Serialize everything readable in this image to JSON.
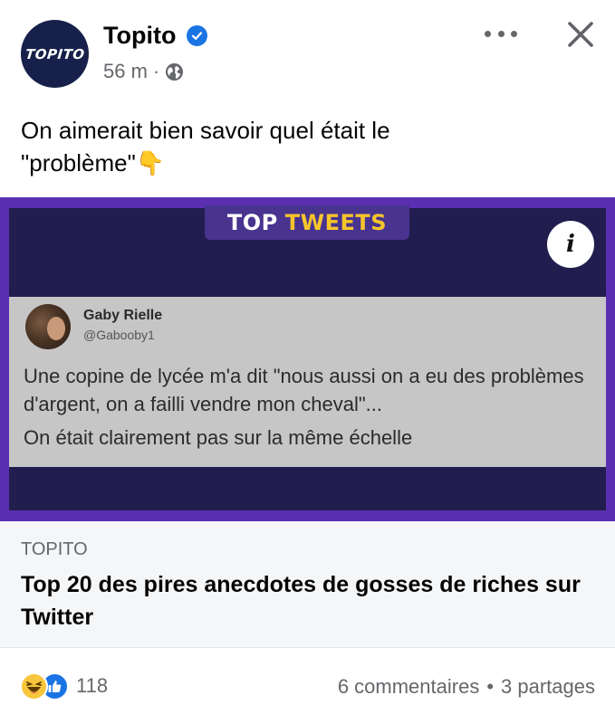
{
  "header": {
    "avatar_text": "TOPITO",
    "page_name": "Topito",
    "time": "56 m",
    "separator": "·"
  },
  "post": {
    "text_line1": "On aimerait bien savoir quel était le",
    "text_line2": "\"problème\"👇"
  },
  "image": {
    "banner_top": "TOP",
    "banner_tweets": "TWEETS",
    "info_label": "i",
    "tweet": {
      "name": "Gaby Rielle",
      "handle": "@Gabooby1",
      "text_line1": "Une copine de lycée m'a dit \"nous aussi on a eu des problèmes d'argent, on a failli vendre mon cheval\"...",
      "text_line2": "On était clairement pas sur la même échelle"
    }
  },
  "link_preview": {
    "source": "TOPITO",
    "title": "Top 20 des pires anecdotes de gosses de riches sur Twitter"
  },
  "footer": {
    "reaction_count": "118",
    "comments": "6 commentaires",
    "dot": "•",
    "shares": "3 partages"
  },
  "colors": {
    "brand_navy": "#16204a",
    "verified_blue": "#1b74e4",
    "frame_purple": "#5a2fb1",
    "tweets_yellow": "#f6c52c"
  },
  "icons": [
    "verified-badge-icon",
    "globe-icon",
    "more-options-icon",
    "close-icon",
    "info-icon",
    "haha-reaction-icon",
    "like-reaction-icon"
  ]
}
